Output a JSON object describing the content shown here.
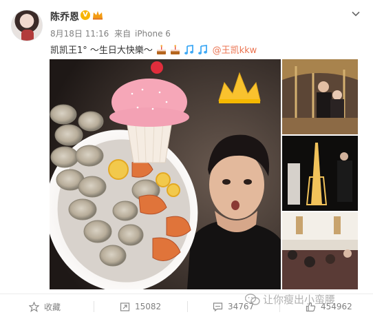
{
  "post": {
    "author": "陈乔恩",
    "verified_badge": "V",
    "date": "8月18日 11:16",
    "source_prefix": "来自",
    "source": "iPhone 6",
    "text": "凯凯王1° ～生日大快樂～",
    "mention": "@王凯kkw",
    "emoji_icons": [
      "cake-icon",
      "cake-icon",
      "music-note-icon",
      "music-note-icon",
      "link-icon"
    ]
  },
  "images": {
    "main": "birthday-selfie-with-seafood-platter-and-cupcake",
    "thumbnails": [
      "carousel-couple-photo",
      "eiffel-tower-night-photo",
      "theater-audience-photo"
    ]
  },
  "footer": {
    "favorite_label": "收藏",
    "repost_count": "15082",
    "comment_count": "34767",
    "like_count": "454962"
  },
  "watermark": {
    "text": "让你瘦出小蛮腰"
  },
  "colors": {
    "link": "#eb7350",
    "verified": "#f7b500",
    "meta_gray": "#808080"
  }
}
